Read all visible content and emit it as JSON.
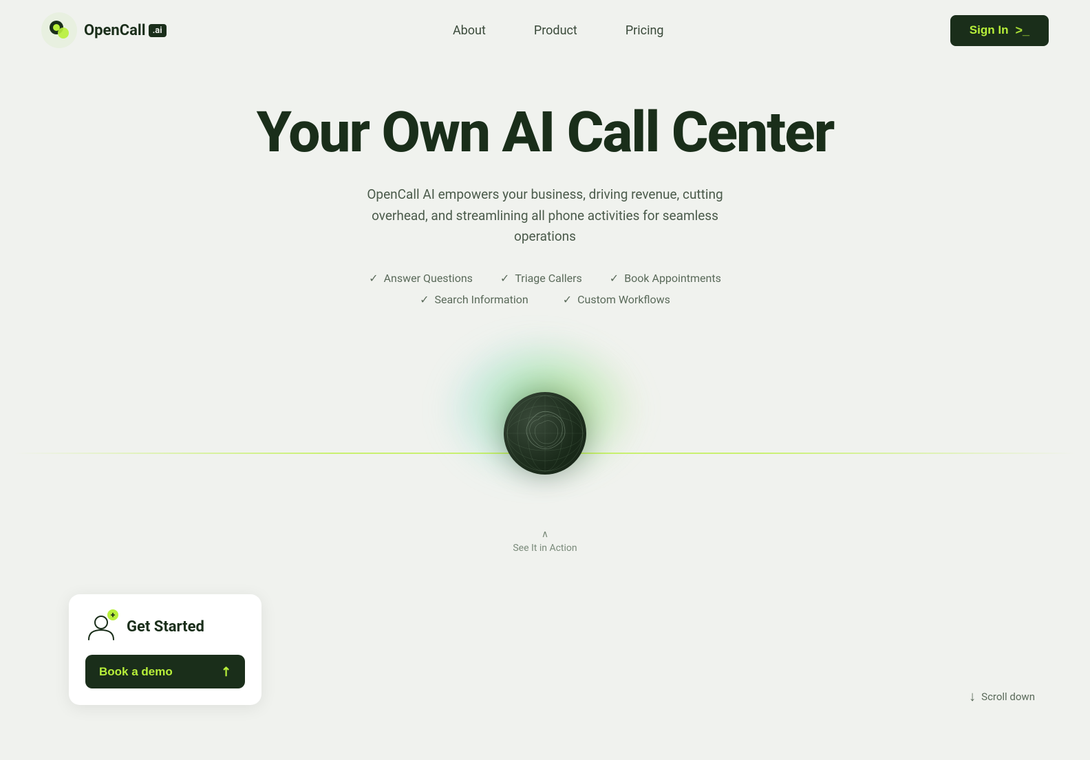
{
  "brand": {
    "name": "OpenCall",
    "badge": ".ai",
    "logo_alt": "OpenCall AI Logo"
  },
  "nav": {
    "links": [
      {
        "label": "About",
        "href": "#"
      },
      {
        "label": "Product",
        "href": "#"
      },
      {
        "label": "Pricing",
        "href": "#"
      }
    ],
    "signin_label": "Sign In",
    "terminal_symbol": ">_"
  },
  "hero": {
    "title": "Your Own AI Call Center",
    "subtitle": "OpenCall AI empowers your business, driving revenue, cutting overhead, and streamlining all phone activities for seamless operations"
  },
  "features": {
    "row1": [
      {
        "label": "Answer Questions"
      },
      {
        "label": "Triage Callers"
      },
      {
        "label": "Book Appointments"
      }
    ],
    "row2": [
      {
        "label": "Search Information"
      },
      {
        "label": "Custom Workflows"
      }
    ]
  },
  "orb": {
    "see_action_label": "See It in Action"
  },
  "cta_card": {
    "title": "Get Started",
    "button_label": "Book a demo"
  },
  "scroll": {
    "label": "Scroll down"
  }
}
